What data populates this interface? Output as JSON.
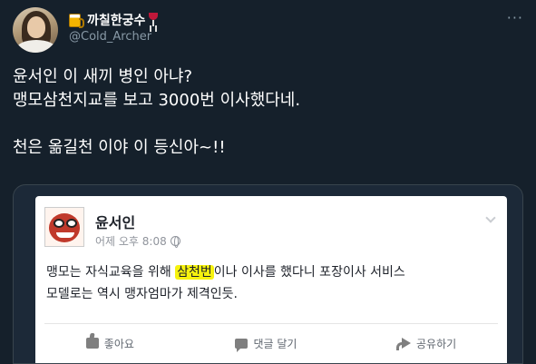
{
  "tweet": {
    "author": {
      "display_name": "까칠한궁수",
      "handle": "@Cold_Archer"
    },
    "more_label": "···",
    "text_lines": [
      "윤서인 이 새끼 병인 아냐?",
      "맹모삼천지교를 보고 3000번 이사했다네.",
      "",
      "천은 옮길천 이야 이 등신아~!!"
    ]
  },
  "embedded_post": {
    "name": "윤서인",
    "time": "어제 오후 8:08",
    "body": {
      "line1_before": "맹모는 자식교육을 위해 ",
      "line1_highlight": "삼천번",
      "line1_after": "이나 이사를 했다니 포장이사 서비스",
      "line2": "모델로는 역시 맹자엄마가 제격인듯."
    },
    "actions": {
      "like": "좋아요",
      "comment": "댓글 달기",
      "share": "공유하기"
    }
  },
  "colors": {
    "background": "#15202b",
    "highlight": "#f6f20f",
    "secondary_text": "#8899a6"
  }
}
